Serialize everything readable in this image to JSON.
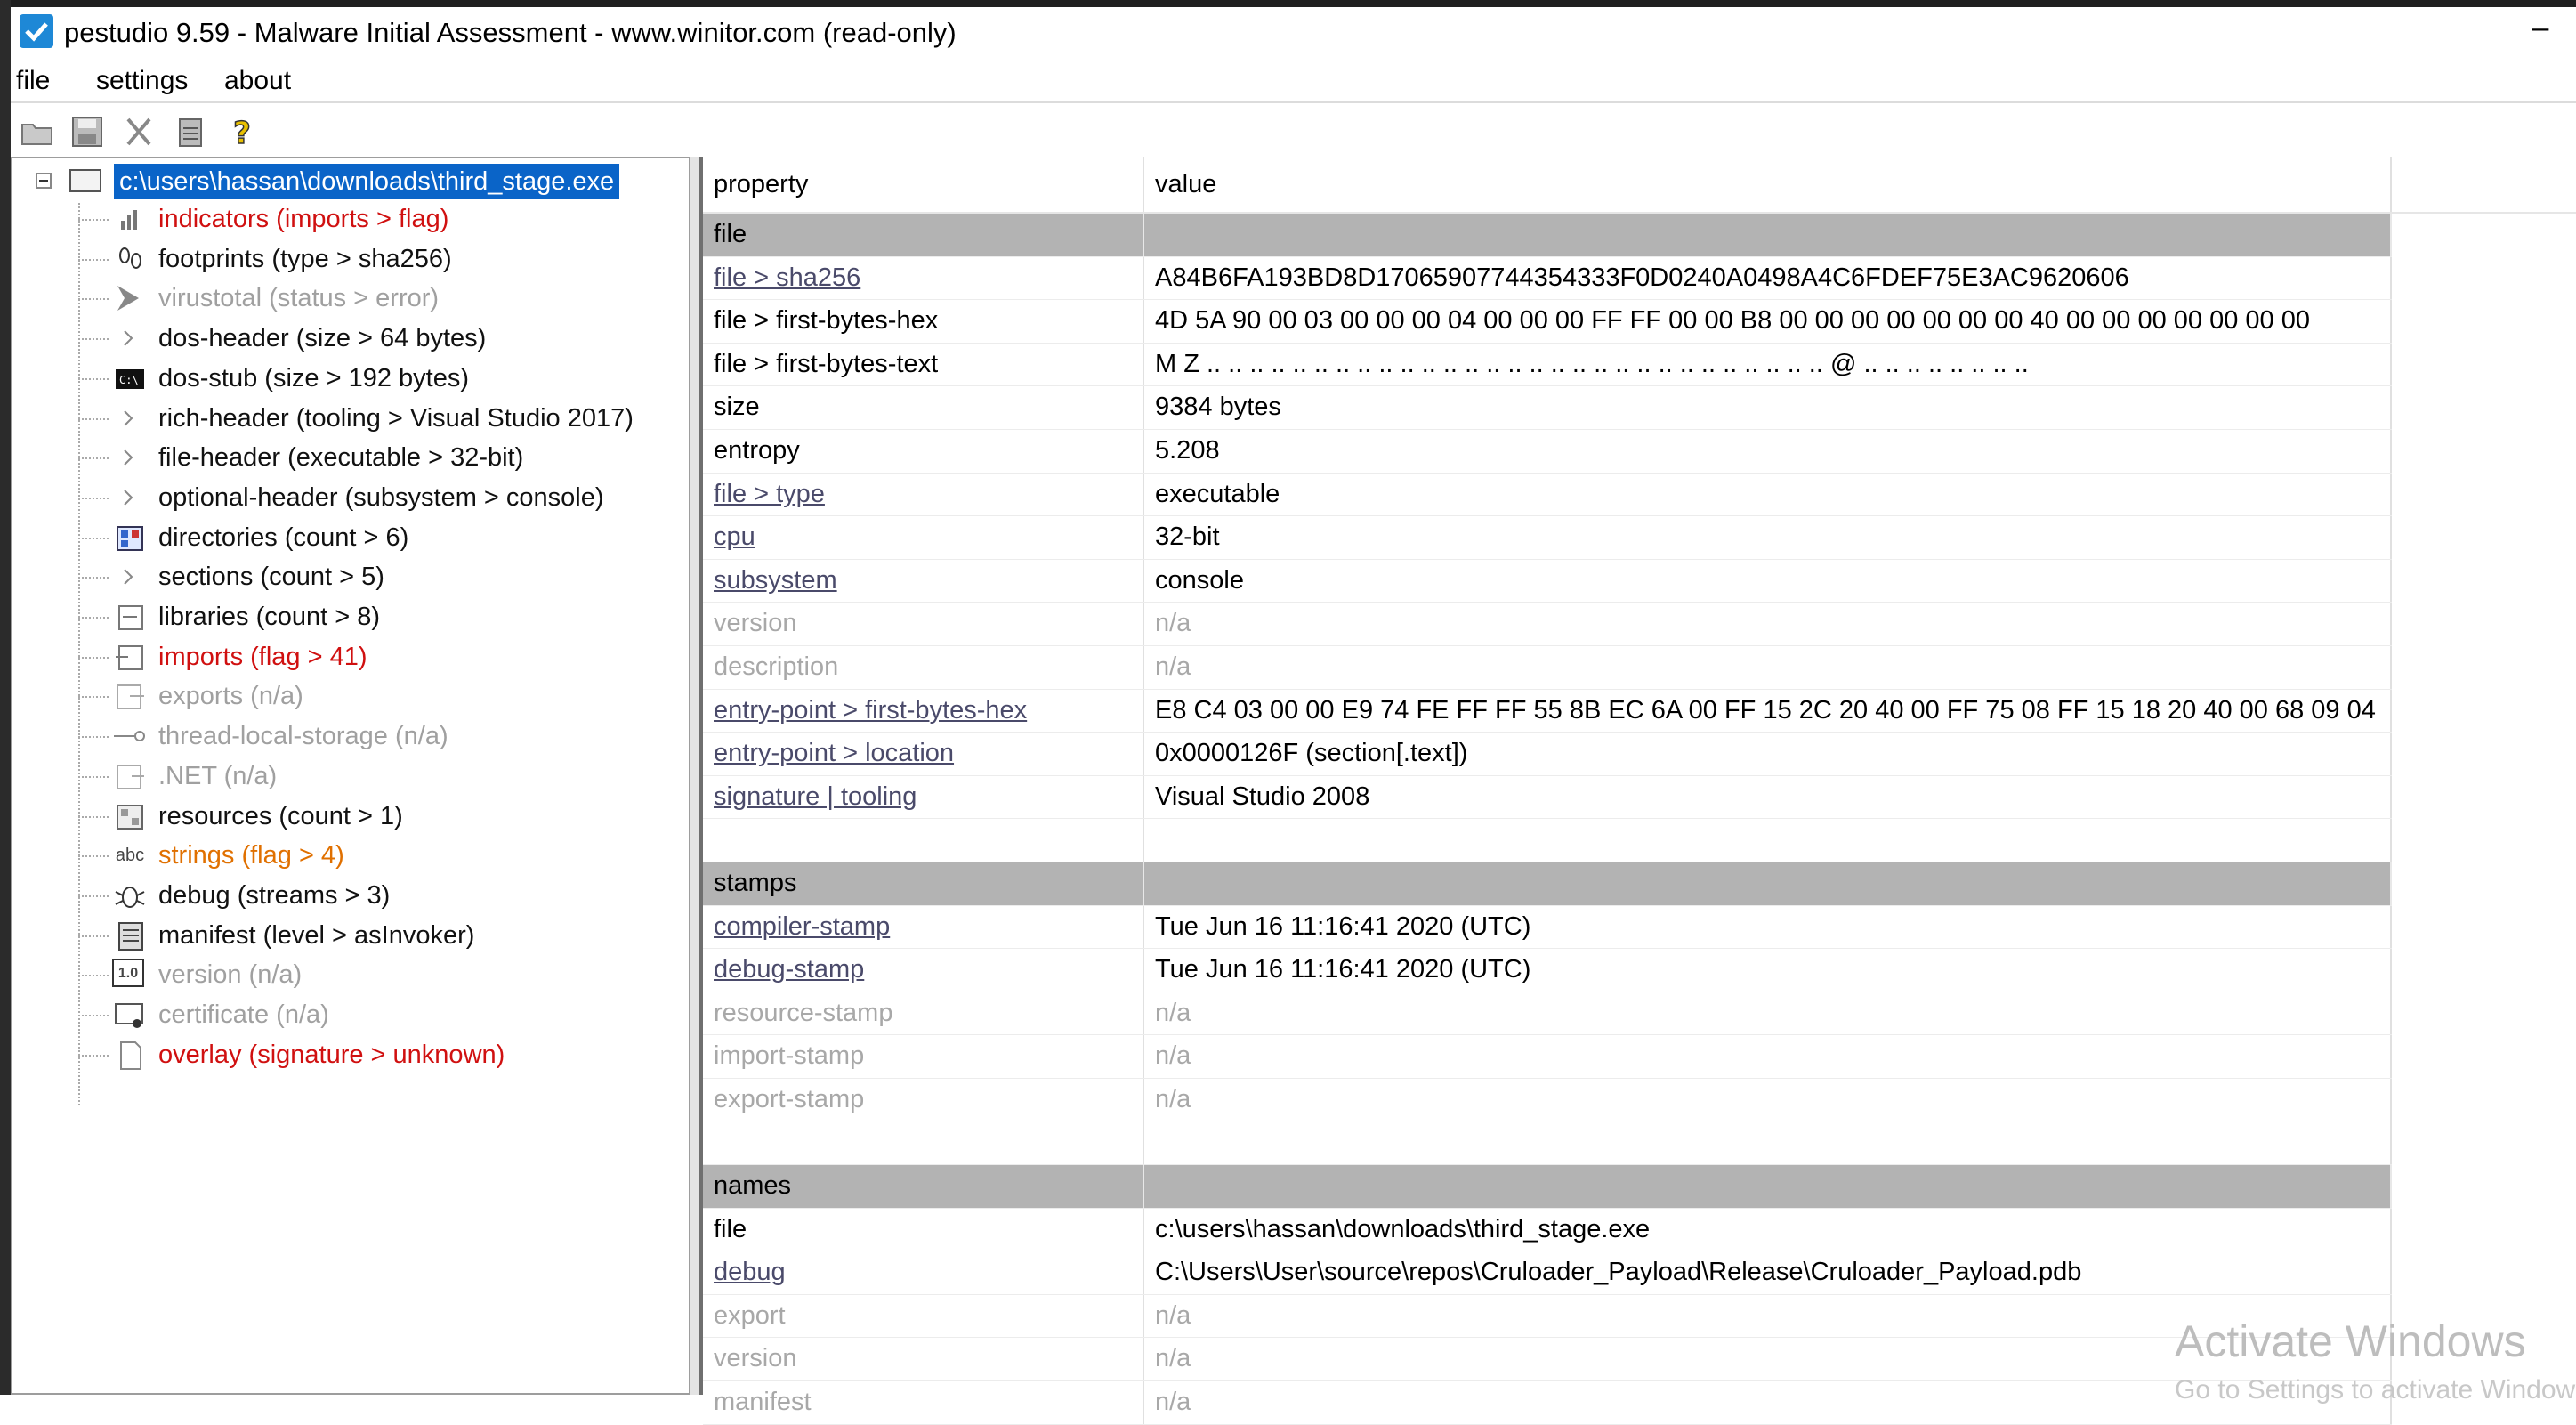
{
  "window": {
    "title": "pestudio 9.59 - Malware Initial Assessment - www.winitor.com (read-only)",
    "minimize_label": "–"
  },
  "menu": [
    "file",
    "settings",
    "about"
  ],
  "toolbar": [
    "open-folder-icon",
    "save-icon",
    "cut-icon",
    "clipboard-icon",
    "help-icon"
  ],
  "tree": {
    "root": "c:\\users\\hassan\\downloads\\third_stage.exe",
    "items": [
      {
        "label": "indicators (imports > flag)",
        "color": "red",
        "icon": "chart-icon"
      },
      {
        "label": "footprints (type > sha256)",
        "color": "black",
        "icon": "footprint-icon"
      },
      {
        "label": "virustotal (status > error)",
        "color": "gray",
        "icon": "virustotal-icon"
      },
      {
        "label": "dos-header (size > 64 bytes)",
        "color": "black",
        "icon": "chevron-right-icon"
      },
      {
        "label": "dos-stub (size > 192 bytes)",
        "color": "black",
        "icon": "console-icon"
      },
      {
        "label": "rich-header (tooling > Visual Studio 2017)",
        "color": "black",
        "icon": "chevron-right-icon"
      },
      {
        "label": "file-header (executable > 32-bit)",
        "color": "black",
        "icon": "chevron-right-icon"
      },
      {
        "label": "optional-header (subsystem > console)",
        "color": "black",
        "icon": "chevron-right-icon"
      },
      {
        "label": "directories (count > 6)",
        "color": "black",
        "icon": "directories-icon"
      },
      {
        "label": "sections (count > 5)",
        "color": "black",
        "icon": "chevron-right-icon"
      },
      {
        "label": "libraries (count > 8)",
        "color": "black",
        "icon": "library-icon"
      },
      {
        "label": "imports (flag > 41)",
        "color": "red",
        "icon": "import-icon"
      },
      {
        "label": "exports (n/a)",
        "color": "gray",
        "icon": "export-icon"
      },
      {
        "label": "thread-local-storage (n/a)",
        "color": "gray",
        "icon": "tls-icon"
      },
      {
        "label": ".NET (n/a)",
        "color": "gray",
        "icon": "dotnet-icon"
      },
      {
        "label": "resources (count > 1)",
        "color": "black",
        "icon": "resources-icon"
      },
      {
        "label": "strings (flag > 4)",
        "color": "orange",
        "icon": "abc-icon"
      },
      {
        "label": "debug (streams > 3)",
        "color": "black",
        "icon": "bug-icon"
      },
      {
        "label": "manifest (level > asInvoker)",
        "color": "black",
        "icon": "manifest-icon"
      },
      {
        "label": "version (n/a)",
        "color": "gray",
        "icon": "version-icon"
      },
      {
        "label": "certificate (n/a)",
        "color": "gray",
        "icon": "certificate-icon"
      },
      {
        "label": "overlay (signature > unknown)",
        "color": "red",
        "icon": "page-icon"
      }
    ],
    "abc_glyph": "abc",
    "version_glyph": "1.0"
  },
  "grid": {
    "headers": {
      "property": "property",
      "value": "value"
    },
    "rows": [
      {
        "kind": "section",
        "property": "file",
        "value": ""
      },
      {
        "kind": "link",
        "property": "file > sha256",
        "value": "A84B6FA193BD8D17065907744354333F0D0240A0498A4C6FDEF75E3AC9620606"
      },
      {
        "kind": "plain",
        "property": "file > first-bytes-hex",
        "value": "4D 5A 90 00 03 00 00 00 04 00 00 00 FF FF 00 00 B8 00 00 00 00 00 00 00 40 00 00 00 00 00 00 00"
      },
      {
        "kind": "plain",
        "property": "file > first-bytes-text",
        "value": "M Z .. .. .. .. .. .. .. .. .. .. .. .. .. .. .. .. .. .. .. .. .. .. .. .. .. .. .. .. .. @ .. .. .. .. .. .. .. .."
      },
      {
        "kind": "plain",
        "property": "size",
        "value": "9384 bytes"
      },
      {
        "kind": "plain",
        "property": "entropy",
        "value": "5.208"
      },
      {
        "kind": "link",
        "property": "file > type",
        "value": "executable"
      },
      {
        "kind": "link",
        "property": "cpu",
        "value": "32-bit"
      },
      {
        "kind": "link",
        "property": "subsystem",
        "value": "console"
      },
      {
        "kind": "dim",
        "property": "version",
        "value": "n/a"
      },
      {
        "kind": "dim",
        "property": "description",
        "value": "n/a"
      },
      {
        "kind": "link",
        "property": "entry-point > first-bytes-hex",
        "value": "E8 C4 03 00 00 E9 74 FE FF FF 55 8B EC 6A 00 FF 15 2C 20 40 00 FF 75 08 FF 15 18 20 40 00 68 09 04"
      },
      {
        "kind": "link",
        "property": "entry-point > location",
        "value": "0x0000126F (section[.text])"
      },
      {
        "kind": "link",
        "property": "signature | tooling",
        "value": "Visual Studio 2008"
      },
      {
        "kind": "blank",
        "property": "",
        "value": ""
      },
      {
        "kind": "section",
        "property": "stamps",
        "value": ""
      },
      {
        "kind": "link",
        "property": "compiler-stamp",
        "value": "Tue Jun 16 11:16:41 2020 (UTC)"
      },
      {
        "kind": "link",
        "property": "debug-stamp",
        "value": "Tue Jun 16 11:16:41 2020 (UTC)"
      },
      {
        "kind": "dim",
        "property": "resource-stamp",
        "value": "n/a"
      },
      {
        "kind": "dim",
        "property": "import-stamp",
        "value": "n/a"
      },
      {
        "kind": "dim",
        "property": "export-stamp",
        "value": "n/a"
      },
      {
        "kind": "blank",
        "property": "",
        "value": ""
      },
      {
        "kind": "section",
        "property": "names",
        "value": ""
      },
      {
        "kind": "plain",
        "property": "file",
        "value": "c:\\users\\hassan\\downloads\\third_stage.exe"
      },
      {
        "kind": "link",
        "property": "debug",
        "value": "C:\\Users\\User\\source\\repos\\Cruloader_Payload\\Release\\Cruloader_Payload.pdb"
      },
      {
        "kind": "dim",
        "property": "export",
        "value": "n/a"
      },
      {
        "kind": "dim",
        "property": "version",
        "value": "n/a"
      },
      {
        "kind": "dim",
        "property": "manifest",
        "value": "n/a"
      }
    ]
  },
  "watermark": {
    "line1": "Activate Windows",
    "line2": "Go to Settings to activate Windows."
  },
  "colors": {
    "selection": "#0a64c8",
    "section_bg": "#b3b3b3",
    "red": "#d01010",
    "orange": "#e07000",
    "gray": "#a0a0a0"
  }
}
